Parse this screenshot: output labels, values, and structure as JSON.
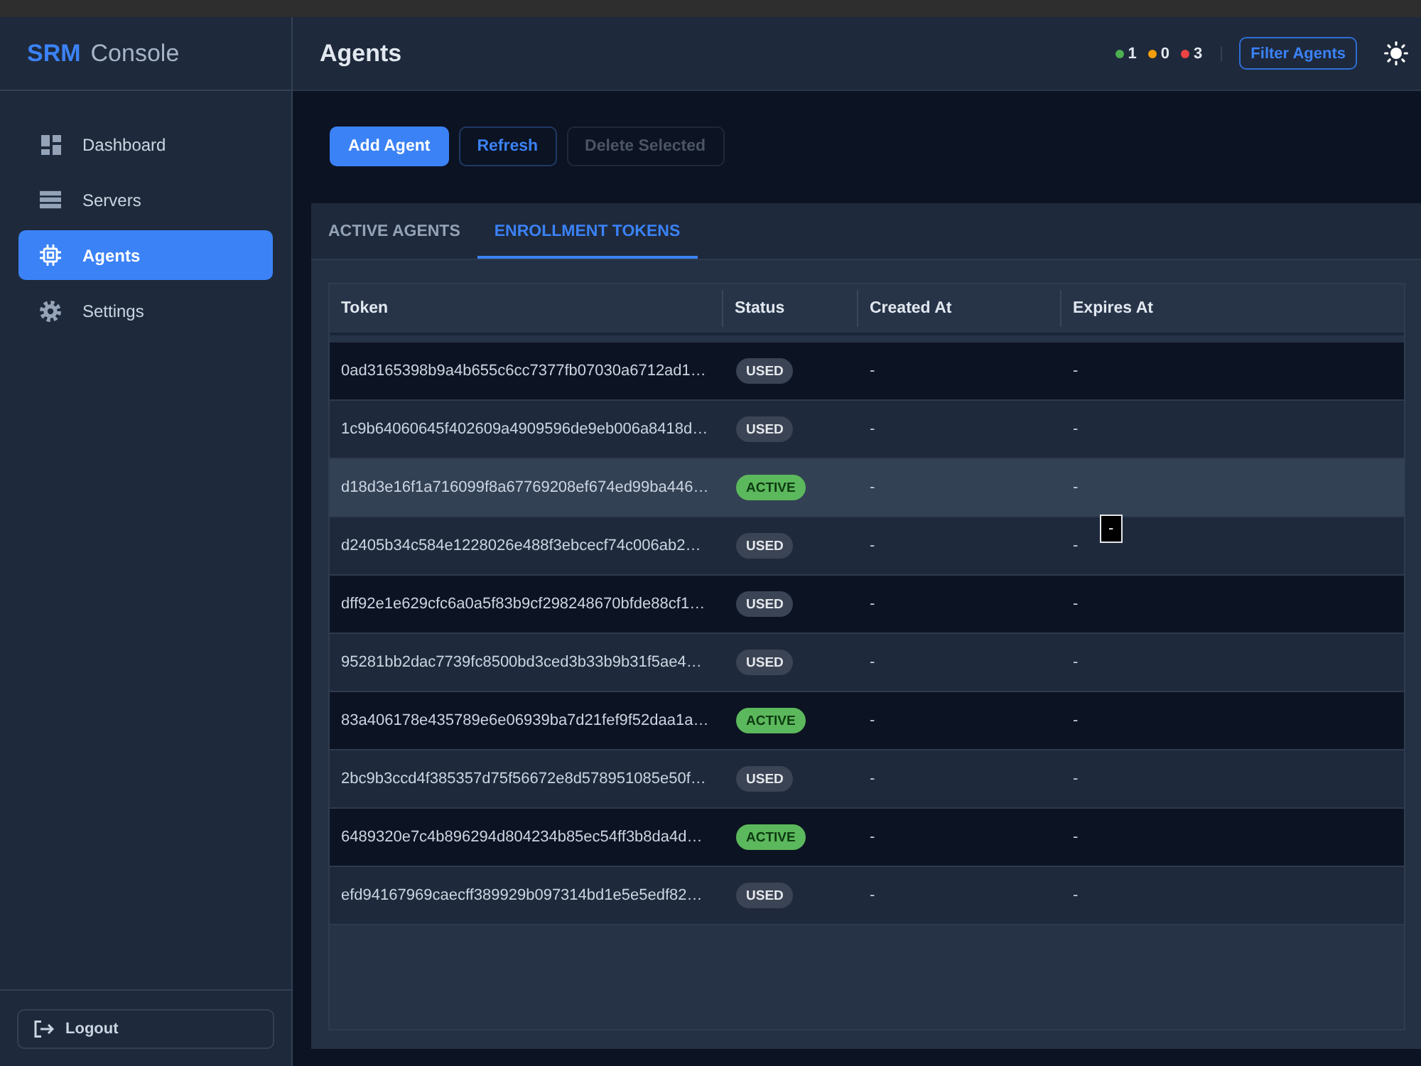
{
  "sidebar": {
    "brand": {
      "name": "SRM",
      "subtitle": "Console"
    },
    "items": [
      {
        "label": "Dashboard",
        "selected": false
      },
      {
        "label": "Servers",
        "selected": false
      },
      {
        "label": "Agents",
        "selected": true
      },
      {
        "label": "Settings",
        "selected": false
      }
    ],
    "logout": "Logout"
  },
  "header": {
    "title": "Agents",
    "status_counts": [
      {
        "count": "1",
        "color": "#4caf50"
      },
      {
        "count": "0",
        "color": "#f59e0b"
      },
      {
        "count": "3",
        "color": "#ef4444"
      }
    ],
    "filter_button": "Filter Agents"
  },
  "actions": [
    {
      "label": "Add Agent",
      "kind": "primary",
      "disabled": false
    },
    {
      "label": "Refresh",
      "kind": "outline",
      "disabled": false
    },
    {
      "label": "Delete Selected",
      "kind": "outline",
      "disabled": true
    }
  ],
  "tabs": [
    {
      "label": "ACTIVE AGENTS",
      "selected": false
    },
    {
      "label": "ENROLLMENT TOKENS",
      "selected": true
    }
  ],
  "table": {
    "columns": [
      "Token",
      "Status",
      "Created At",
      "Expires At"
    ],
    "rows": [
      {
        "token": "0ad3165398b9a4b655c6cc7377fb07030a6712ad1…",
        "status": {
          "label": "USED",
          "kind": "used"
        },
        "created_at": "-",
        "expires_at": "-",
        "highlighted": false
      },
      {
        "token": "1c9b64060645f402609a4909596de9eb006a8418d…",
        "status": {
          "label": "USED",
          "kind": "used"
        },
        "created_at": "-",
        "expires_at": "-",
        "highlighted": false
      },
      {
        "token": "d18d3e16f1a716099f8a67769208ef674ed99ba446…",
        "status": {
          "label": "ACTIVE",
          "kind": "active"
        },
        "created_at": "-",
        "expires_at": "-",
        "highlighted": true
      },
      {
        "token": "d2405b34c584e1228026e488f3ebcecf74c006ab2…",
        "status": {
          "label": "USED",
          "kind": "used"
        },
        "created_at": "-",
        "expires_at": "-",
        "highlighted": false
      },
      {
        "token": "dff92e1e629cfc6a0a5f83b9cf298248670bfde88cf1…",
        "status": {
          "label": "USED",
          "kind": "used"
        },
        "created_at": "-",
        "expires_at": "-",
        "highlighted": false
      },
      {
        "token": "95281bb2dac7739fc8500bd3ced3b33b9b31f5ae4…",
        "status": {
          "label": "USED",
          "kind": "used"
        },
        "created_at": "-",
        "expires_at": "-",
        "highlighted": false
      },
      {
        "token": "83a406178e435789e6e06939ba7d21fef9f52daa1a…",
        "status": {
          "label": "ACTIVE",
          "kind": "active"
        },
        "created_at": "-",
        "expires_at": "-",
        "highlighted": false
      },
      {
        "token": "2bc9b3ccd4f385357d75f56672e8d578951085e50f…",
        "status": {
          "label": "USED",
          "kind": "used"
        },
        "created_at": "-",
        "expires_at": "-",
        "highlighted": false
      },
      {
        "token": "6489320e7c4b896294d804234b85ec54ff3b8da4d…",
        "status": {
          "label": "ACTIVE",
          "kind": "active"
        },
        "created_at": "-",
        "expires_at": "-",
        "highlighted": false
      },
      {
        "token": "efd94167969caecff389929b097314bd1e5e5edf82…",
        "status": {
          "label": "USED",
          "kind": "used"
        },
        "created_at": "-",
        "expires_at": "-",
        "highlighted": false
      }
    ]
  },
  "tooltip": {
    "text": "-"
  }
}
